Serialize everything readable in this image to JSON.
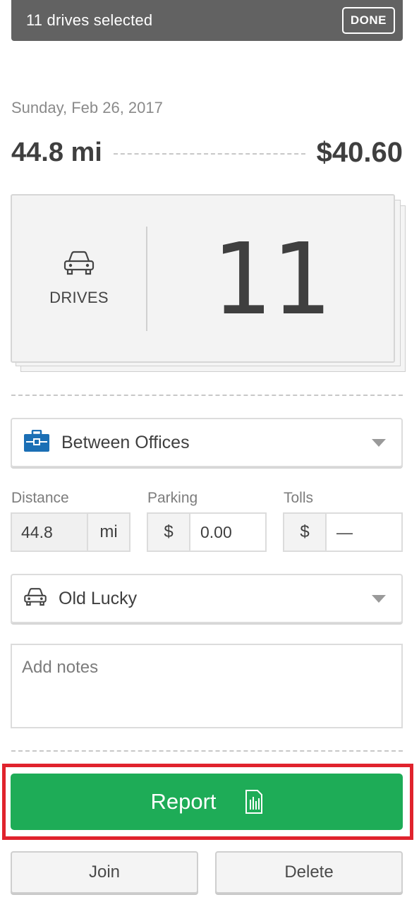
{
  "topbar": {
    "selection_text": "11 drives selected",
    "done_label": "DONE"
  },
  "summary": {
    "date": "Sunday, Feb 26, 2017",
    "distance": "44.8 mi",
    "amount": "$40.60"
  },
  "drives_card": {
    "label": "DRIVES",
    "count": "11"
  },
  "purpose_select": {
    "value": "Between Offices",
    "icon": "briefcase-icon",
    "icon_color": "#1b6fb5"
  },
  "fields": {
    "distance": {
      "label": "Distance",
      "value": "44.8",
      "unit": "mi"
    },
    "parking": {
      "label": "Parking",
      "prefix": "$",
      "value": "0.00"
    },
    "tolls": {
      "label": "Tolls",
      "prefix": "$",
      "value": "—"
    }
  },
  "vehicle_select": {
    "value": "Old Lucky",
    "icon": "car-icon"
  },
  "notes": {
    "placeholder": "Add notes"
  },
  "actions": {
    "report_label": "Report",
    "join_label": "Join",
    "delete_label": "Delete"
  },
  "colors": {
    "topbar": "#626262",
    "report_button": "#1eac57",
    "highlight_frame": "#e0232d"
  }
}
